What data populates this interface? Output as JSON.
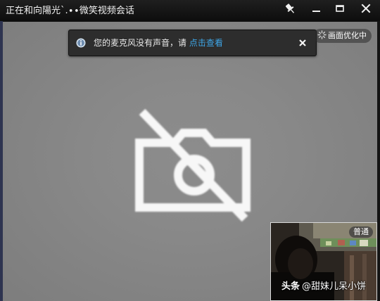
{
  "window": {
    "title": "正在和向陽光`.∙∙微笑视频会话"
  },
  "titlebar_buttons": [
    "pin-icon",
    "minimize-icon",
    "maximize-icon",
    "close-icon"
  ],
  "notification": {
    "icon": "info-icon",
    "message": "您的麦克风没有声音，请",
    "link_text": "点击查看",
    "close_icon": "close-icon"
  },
  "optimize_badge": {
    "icon": "loading-spinner-icon",
    "label": "画面优化中"
  },
  "main_video": {
    "icon": "camera-off-icon"
  },
  "self_preview": {
    "quality_label": "普通"
  },
  "watermark": {
    "brand": "头条",
    "handle": "@甜妹儿呆小饼"
  },
  "colors": {
    "titlebar": "#141414",
    "video_background": "#888888",
    "toast_background": "#2d2d2d",
    "link": "#3ea6e8"
  }
}
